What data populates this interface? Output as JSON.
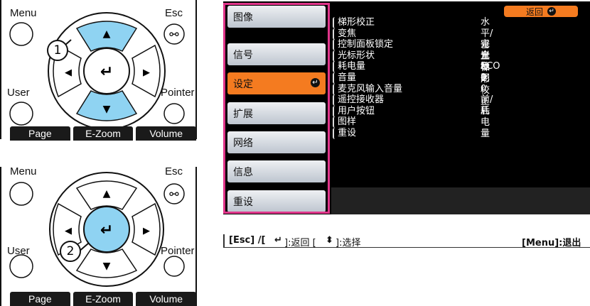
{
  "remote_top": {
    "menu_label": "Menu",
    "esc_label": "Esc",
    "user_label": "User",
    "pointer_label": "Pointer",
    "step_number": "1",
    "buttons": [
      "Page",
      "E-Zoom",
      "Volume"
    ]
  },
  "remote_bottom": {
    "menu_label": "Menu",
    "esc_label": "Esc",
    "user_label": "User",
    "pointer_label": "Pointer",
    "step_number": "2",
    "buttons": [
      "Page",
      "E-Zoom",
      "Volume"
    ]
  },
  "menu": {
    "items": [
      "图像",
      "信号",
      "设定",
      "扩展",
      "网络",
      "信息",
      "重设"
    ],
    "selected_index": 2,
    "back_label": "返回",
    "submenu": [
      {
        "label": "梯形校正",
        "value": "水平/垂直梯形校正"
      },
      {
        "label": "变焦",
        "value": ""
      },
      {
        "label": "控制面板锁定",
        "value": "完全锁闭"
      },
      {
        "label": "光标形状",
        "value": "光标1"
      },
      {
        "label": "耗电量",
        "value": "ECO"
      },
      {
        "label": "音量",
        "value": "0"
      },
      {
        "label": "麦克风输入音量",
        "value": "0"
      },
      {
        "label": "遥控接收器",
        "value": "前/后"
      },
      {
        "label": "用户按钮",
        "value": "耗电量"
      },
      {
        "label": "图样",
        "value": ""
      },
      {
        "label": "重设",
        "value": ""
      }
    ]
  },
  "hint": {
    "left": "[Esc] /[",
    "left2": "]:返回 [",
    "left3": "]:选择",
    "right": "[Menu]:退出"
  },
  "colors": {
    "selected": "#f47b20",
    "highlight": "#e0358a",
    "dpad_blue": "#8fd3f2"
  }
}
